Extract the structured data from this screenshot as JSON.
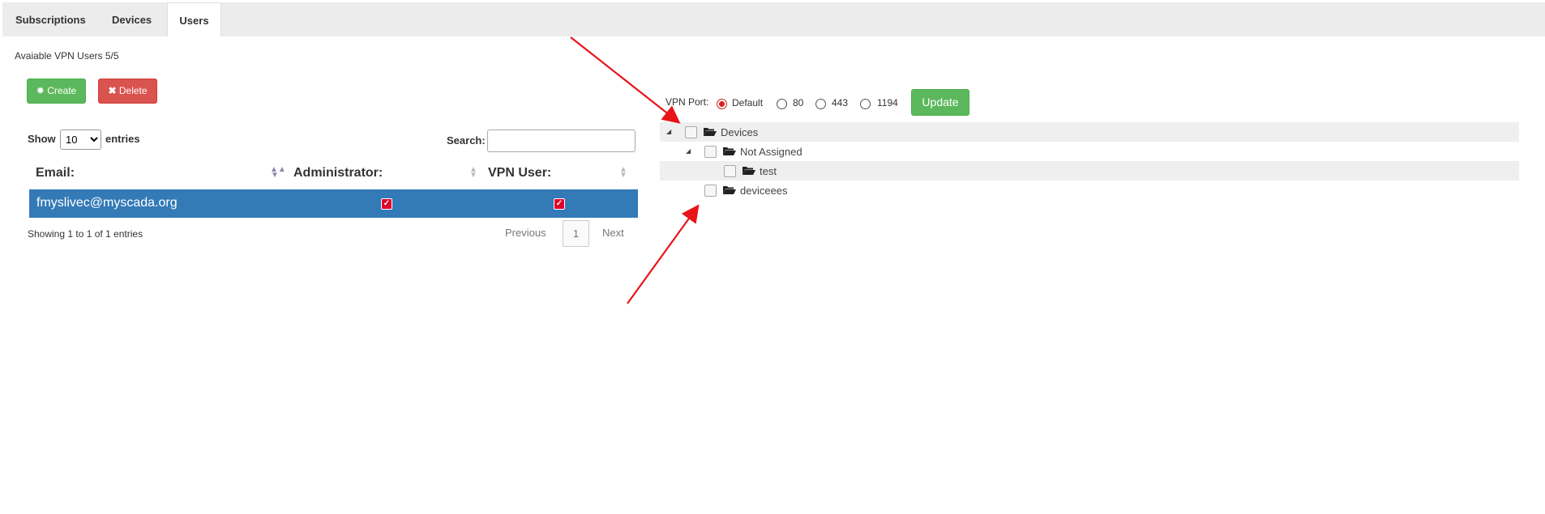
{
  "tabs": [
    {
      "label": "Subscriptions"
    },
    {
      "label": "Devices"
    },
    {
      "label": "Users",
      "active": true
    }
  ],
  "available_users": "Avaiable VPN Users 5/5",
  "buttons": {
    "create": "Create",
    "delete": "Delete",
    "update": "Update"
  },
  "table_controls": {
    "show_label": "Show",
    "page_length": "10",
    "entries_label": "entries",
    "search_label": "Search:",
    "search_value": ""
  },
  "table": {
    "headers": [
      "Email:",
      "Administrator:",
      "VPN User:"
    ],
    "rows": [
      {
        "email": "fmyslivec@myscada.org",
        "administrator": true,
        "vpn_user": true
      }
    ],
    "info": "Showing 1 to 1 of 1 entries",
    "pagination": {
      "previous": "Previous",
      "current_page": "1",
      "next": "Next"
    }
  },
  "vpn_port": {
    "label": "VPN Port:",
    "options": [
      "Default",
      "80",
      "443",
      "1194"
    ],
    "selected": "Default"
  },
  "tree": {
    "root": "Devices",
    "children": [
      {
        "label": "Not Assigned",
        "children": [
          {
            "label": "test"
          }
        ]
      },
      {
        "label": "deviceees"
      }
    ]
  },
  "colors": {
    "accent_green": "#5cb85c",
    "danger_red": "#d9534f",
    "row_selected_blue": "#337ab7",
    "annotation_arrow": "#e8141a"
  }
}
